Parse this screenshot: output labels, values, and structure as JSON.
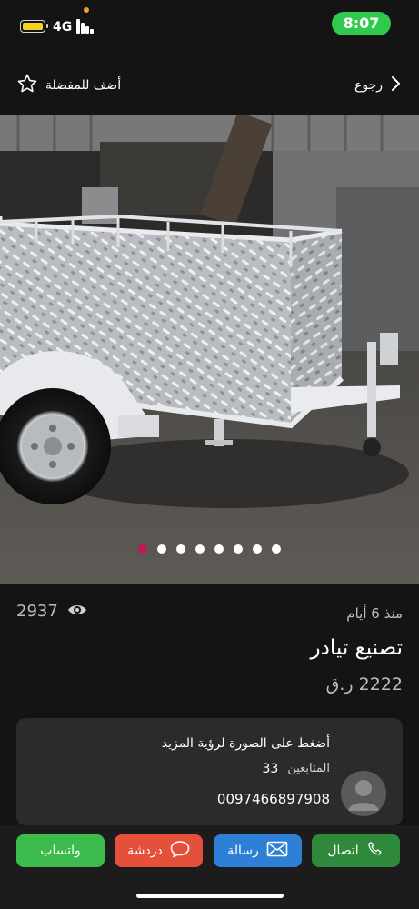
{
  "status_bar": {
    "network": "4G",
    "time": "8:07",
    "battery_color": "#f7d21e",
    "time_pill_color": "#2fc94e"
  },
  "header": {
    "favorite_label": "أضف للمفضلة",
    "favorite_icon": "star-outline-icon",
    "back_label": "رجوع",
    "back_icon": "chevron-right-icon"
  },
  "gallery": {
    "image_description_icon": "trailer-photo",
    "page_count": 8,
    "active_index": 0,
    "active_dot_color": "#c2185b"
  },
  "listing": {
    "views": "2937",
    "views_icon": "eye-icon",
    "posted": "منذ 6 أيام",
    "title": "تصنيع تيادر",
    "price": "2222 ر.ق"
  },
  "seller": {
    "hint": "أضغط على الصورة لرؤية المزيد",
    "followers_label": "المتابعين",
    "followers_count": "33",
    "phone": "0097466897908",
    "avatar_icon": "user-avatar-icon"
  },
  "actions": {
    "call": "اتصال",
    "message": "رسالة",
    "chat": "دردشة",
    "whatsapp": "واتساب",
    "colors": {
      "call": "#2e8a3a",
      "message": "#2e7fd6",
      "chat": "#e5503b",
      "whatsapp": "#3dbb4c"
    }
  }
}
